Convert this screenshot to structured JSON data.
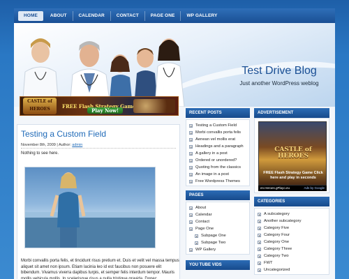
{
  "nav": {
    "items": [
      {
        "label": "HOME",
        "active": true
      },
      {
        "label": "ABOUT"
      },
      {
        "label": "CALENDAR"
      },
      {
        "label": "CONTACT"
      },
      {
        "label": "PAGE ONE"
      },
      {
        "label": "WP GALLERY"
      }
    ]
  },
  "header": {
    "title": "Test Drive Blog",
    "tagline": "Just another WordPress weblog"
  },
  "banner": {
    "logo": "CASTLE of HEROES",
    "text": "FREE Flash Strategy Game",
    "play": "Play Now!"
  },
  "post": {
    "title": "Testing a Custom Field",
    "date": "November 8th, 2009 | Author: ",
    "author": "admin",
    "more": "Nothing to see here.",
    "body": "Morbi convallis porta felis, et tincidunt risus pretium et. Duis et velit vel massa tempus aliquet sit amet non ipsum. Etiam lacinia leo id est faucibus non posuere elit bibendum. Vivamus viverra dapibus turpis, et semper felis interdum tempor. Mauris mollis vehicula mollis. In scelerisque risus a nulla tristique gravida. Donec"
  },
  "recent_posts": {
    "heading": "Recent Posts",
    "items": [
      "Testing a Custom Field",
      "Morbi convallis porta felis",
      "Aenean vel mollis erat",
      "Headings and a paragraph",
      "A gallery in a post",
      "Ordered or unordered?",
      "Quoting from the classics",
      "An image in a post",
      "Free Wordpress Themes"
    ]
  },
  "pages": {
    "heading": "Pages",
    "items": [
      {
        "label": "About",
        "sub": false
      },
      {
        "label": "Calendar",
        "sub": false
      },
      {
        "label": "Contact",
        "sub": false
      },
      {
        "label": "Page One",
        "sub": false
      },
      {
        "label": "Subpage One",
        "sub": true
      },
      {
        "label": "Subpage Two",
        "sub": true
      },
      {
        "label": "WP Gallery",
        "sub": false
      }
    ]
  },
  "youtube": {
    "heading": "You Tube Vids"
  },
  "advertisement": {
    "heading": "Advertisement",
    "ad_title": "CASTLE of HEROES",
    "ad_free": "FREE Flash Strategy Game Click here and play in seconds",
    "ad_source": "en.Heroes.gPlayo.eu",
    "ad_by": "Ads by Google"
  },
  "categories": {
    "heading": "Categories",
    "items": [
      "A subcategory",
      "Another subcategory",
      "Category Five",
      "Category Four",
      "Category One",
      "Category Three",
      "Category Two",
      "FWT",
      "Uncategorized"
    ]
  },
  "colors": {
    "page_bg": "#2a78c4",
    "nav_bg": "#1a4f94",
    "accent": "#1f6ab8",
    "box_head": "#174a8c"
  }
}
